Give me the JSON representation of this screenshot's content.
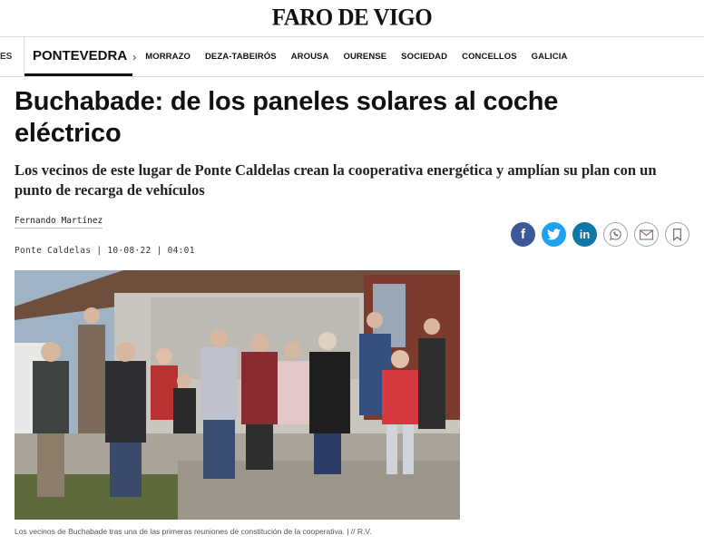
{
  "header": {
    "logo_text": "FARO DE VIGO"
  },
  "nav": {
    "cut_label": "ES",
    "section": "PONTEVEDRA",
    "items": [
      "MORRAZO",
      "DEZA-TABEIRÓS",
      "AROUSA",
      "OURENSE",
      "SOCIEDAD",
      "CONCELLOS",
      "GALICIA"
    ]
  },
  "article": {
    "title": "Buchabade: de los paneles solares al coche eléctrico",
    "subtitle": "Los vecinos de este lugar de Ponte Caldelas crean la cooperativa energética y amplían su plan con un punto de recarga de vehículos",
    "author": "Fernando Martínez",
    "location": "Ponte Caldelas",
    "date": "10·08·22",
    "time": "04:01",
    "sep": "|",
    "caption": "Los vecinos de Buchabade tras una de las primeras reuniones de constitución de la cooperativa. | // R.V."
  },
  "share": {
    "facebook_glyph": "f",
    "linkedin_glyph": "in",
    "icons": [
      "facebook-icon",
      "twitter-icon",
      "linkedin-icon",
      "whatsapp-icon",
      "mail-icon",
      "bookmark-icon"
    ]
  },
  "colors": {
    "facebook": "#3b5998",
    "twitter": "#1da1f2",
    "linkedin": "#0e76a8"
  }
}
